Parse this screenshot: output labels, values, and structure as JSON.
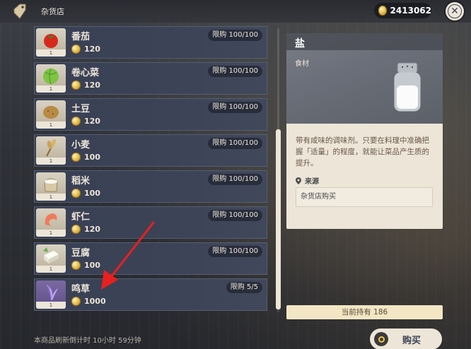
{
  "header": {
    "shop_title": "杂货店",
    "currency_amount": "2413062"
  },
  "items": [
    {
      "name": "番茄",
      "price": "120",
      "limit": "限购 100/100",
      "qty": "1",
      "icon": "tomato-icon"
    },
    {
      "name": "卷心菜",
      "price": "120",
      "limit": "限购 100/100",
      "qty": "1",
      "icon": "cabbage-icon"
    },
    {
      "name": "土豆",
      "price": "120",
      "limit": "限购 100/100",
      "qty": "1",
      "icon": "potato-icon"
    },
    {
      "name": "小麦",
      "price": "100",
      "limit": "限购 100/100",
      "qty": "1",
      "icon": "wheat-icon"
    },
    {
      "name": "稻米",
      "price": "100",
      "limit": "限购 100/100",
      "qty": "1",
      "icon": "rice-icon"
    },
    {
      "name": "虾仁",
      "price": "120",
      "limit": "限购 100/100",
      "qty": "1",
      "icon": "shrimp-icon"
    },
    {
      "name": "豆腐",
      "price": "100",
      "limit": "限购 100/100",
      "qty": "1",
      "icon": "tofu-icon"
    },
    {
      "name": "鸣草",
      "price": "1000",
      "limit": "限购 5/5",
      "qty": "1",
      "icon": "naku-weed-icon"
    }
  ],
  "refresh_text": "本商品刷新倒计时 10小时 59分钟",
  "detail": {
    "title": "盐",
    "type": "食材",
    "description": "带有咸味的调味剂。只要在料理中准确把握「适量」的程度，就能让菜品产生质的提升。",
    "source_label": "来源",
    "source_value": "杂货店购买"
  },
  "owned_text": "当前持有 186",
  "buy_label": "购买",
  "colors": {
    "panel": "#ece5d8",
    "row_bg": "#3c4357",
    "coin": "#e0b441",
    "arrow": "#e8201f"
  }
}
